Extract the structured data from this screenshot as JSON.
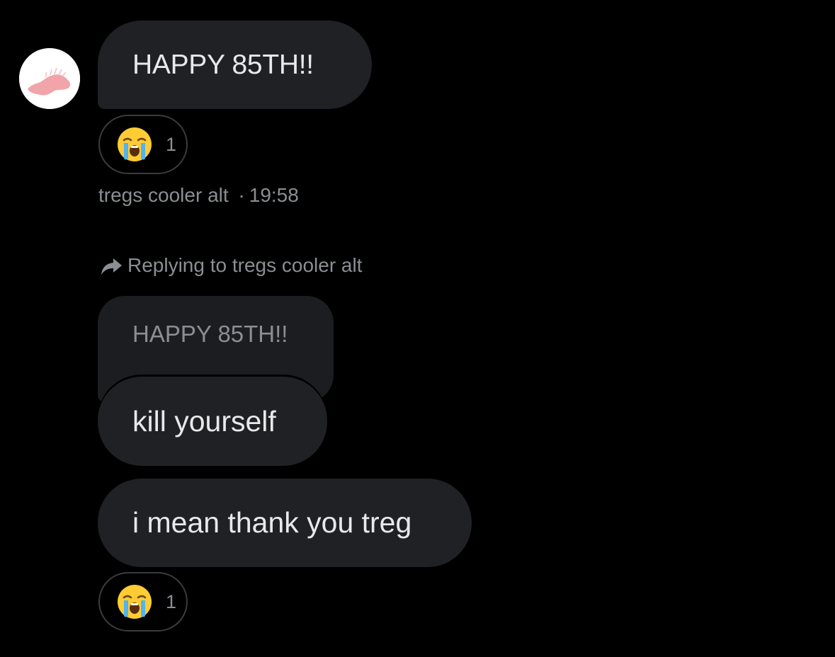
{
  "messages": {
    "incoming": {
      "text": "HAPPY 85TH!!",
      "reaction": {
        "icon": "loudly-crying-face-emoji",
        "count": "1"
      },
      "sender": "tregs cooler alt",
      "separator": "·",
      "time": "19:58"
    },
    "reply_context": {
      "label": "Replying to tregs cooler alt",
      "icon": "reply-arrow-icon",
      "quoted_text": "HAPPY 85TH!!"
    },
    "outgoing": [
      {
        "text": "kill yourself"
      },
      {
        "text": "i mean thank you treg",
        "reaction": {
          "icon": "loudly-crying-face-emoji",
          "count": "1"
        }
      }
    ]
  },
  "colors": {
    "background": "#000000",
    "bubble": "#202124",
    "text": "#e7e9ea",
    "muted": "#8b8e92",
    "avatar_accent": "#f1a4a9"
  }
}
